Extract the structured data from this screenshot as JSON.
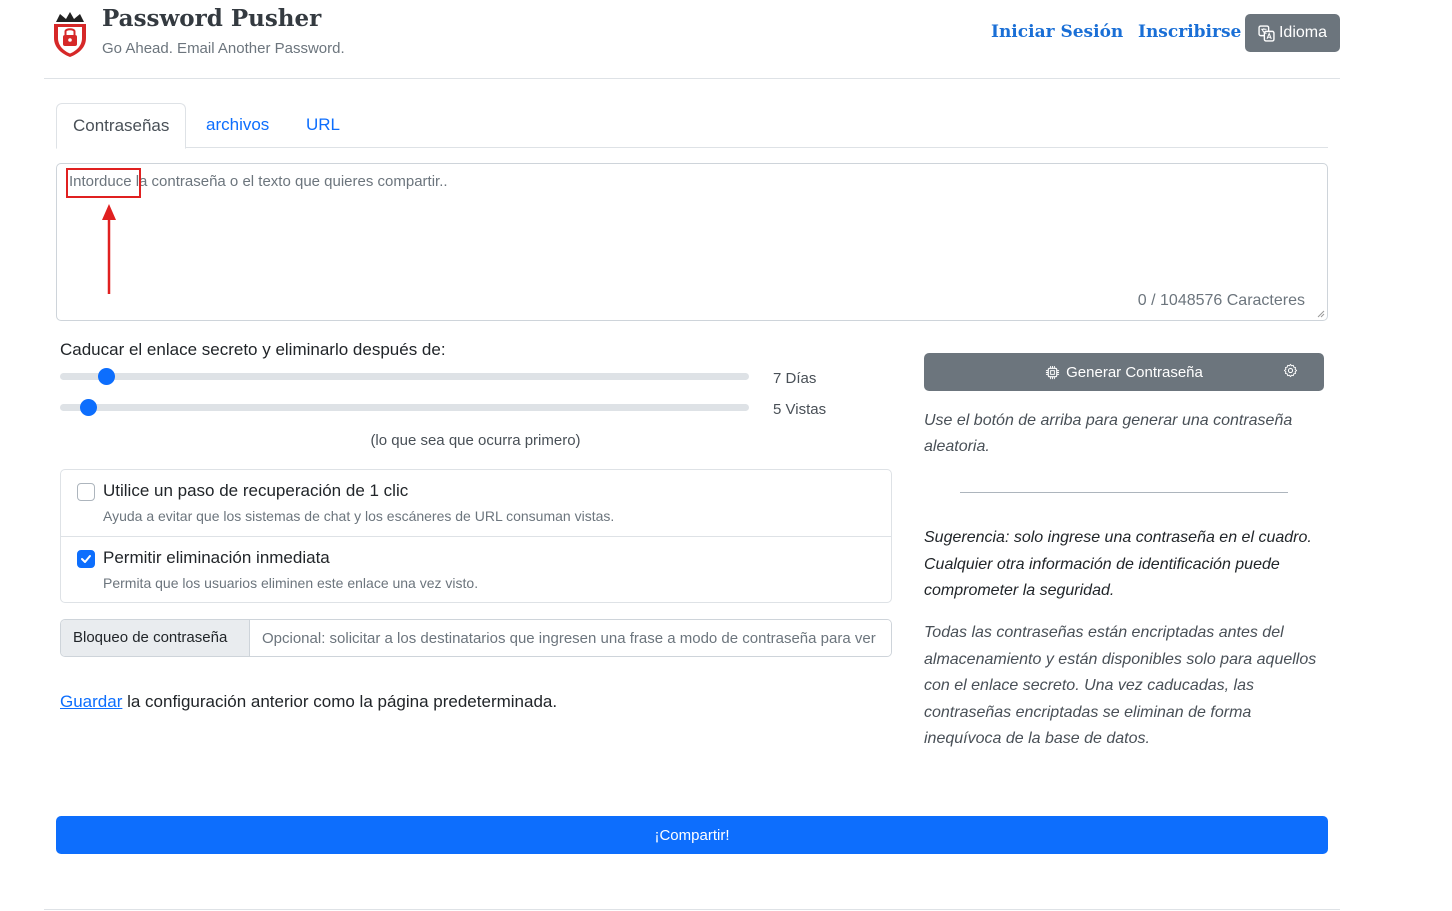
{
  "header": {
    "title": "Password Pusher",
    "tagline": "Go Ahead. Email Another Password.",
    "login_label": "Iniciar Sesión",
    "signup_label": "Inscribirse",
    "language_label": "Idioma"
  },
  "tabs": [
    {
      "label": "Contraseñas",
      "active": true
    },
    {
      "label": "archivos",
      "active": false
    },
    {
      "label": "URL",
      "active": false
    }
  ],
  "payload": {
    "placeholder": "Intorduce la contraseña o el texto que quieres compartir..",
    "value": "",
    "char_count": "0 / 1048576 Caracteres"
  },
  "expiration": {
    "label": "Caducar el enlace secreto y eliminarlo después de:",
    "days": {
      "value": 7,
      "min": 1,
      "max": 90,
      "label": "7 Días"
    },
    "views": {
      "value": 5,
      "min": 1,
      "max": 100,
      "label": "5 Vistas"
    },
    "whichever_note": "(lo que sea que ocurra primero)"
  },
  "options": [
    {
      "title": "Utilice un paso de recuperación de 1 clic",
      "description": "Ayuda a evitar que los sistemas de chat y los escáneres de URL consuman vistas.",
      "checked": false
    },
    {
      "title": "Permitir eliminación inmediata",
      "description": "Permita que los usuarios eliminen este enlace una vez visto.",
      "checked": true
    }
  ],
  "passphrase": {
    "label": "Bloqueo de contraseña",
    "placeholder": "Opcional: solicitar a los destinatarios que ingresen una frase a modo de contraseña para ver"
  },
  "save_defaults": {
    "link_label": "Guardar",
    "rest": " la configuración anterior como la página predeterminada."
  },
  "generator": {
    "button_label": "Generar Contraseña",
    "hint": "Use el botón de arriba para generar una contraseña aleatoria."
  },
  "tip": "Sugerencia: solo ingrese una contraseña en el cuadro. Cualquier otra información de identificación puede comprometer la seguridad.",
  "info": "Todas las contraseñas están encriptadas antes del almacenamiento y están disponibles solo para aquellos con el enlace secreto. Una vez caducadas, las contraseñas encriptadas se eliminan de forma inequívoca de la base de datos.",
  "share_label": "¡Compartir!",
  "colors": {
    "primary": "#0d6efd",
    "secondary": "#6c757d",
    "annotation": "#e02020"
  }
}
